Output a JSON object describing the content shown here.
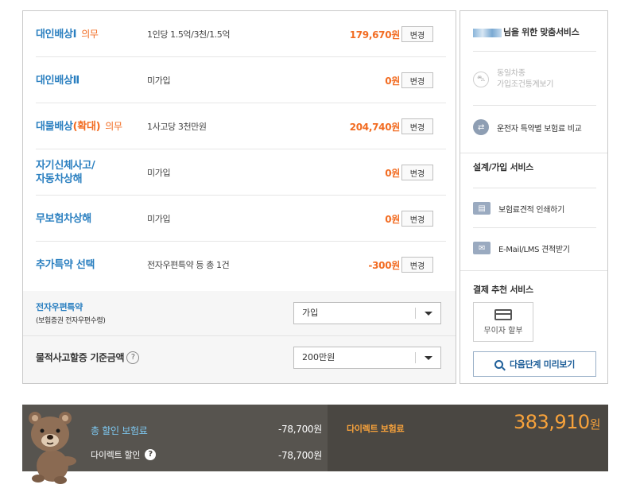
{
  "coverages": [
    {
      "name": "대인배상Ⅰ",
      "tag": "의무",
      "desc": "1인당 1.5억/3천/1.5억",
      "price": "179,670원",
      "btn": "변경"
    },
    {
      "name": "대인배상Ⅱ",
      "desc": "미가입",
      "price": "0원",
      "btn": "변경"
    },
    {
      "name": "대물배상",
      "name_hl": "(확대)",
      "tag": "의무",
      "desc": "1사고당 3천만원",
      "price": "204,740원",
      "btn": "변경"
    },
    {
      "name_line1": "자기신체사고/",
      "name_line2": "자동차상해",
      "desc": "미가입",
      "price": "0원",
      "btn": "변경"
    },
    {
      "name": "무보험차상해",
      "desc": "미가입",
      "price": "0원",
      "btn": "변경"
    },
    {
      "name": "추가특약 선택",
      "desc": "전자우편특약 등 총 1건",
      "price": "-300원",
      "btn": "변경"
    }
  ],
  "ebond": {
    "label": "전자우편특약",
    "sub": "(보험증권 전자우편수령)",
    "value": "가입"
  },
  "property": {
    "label": "물적사고할증 기준금액",
    "help": "?",
    "value": "200만원"
  },
  "side": {
    "custom_title": "님을 위한 맞춤서비스",
    "same_car_line1": "동일차종",
    "same_car_line2": "가입조건통계보기",
    "compare_label": "운전자 특약별 보험료 비교",
    "design_title": "설계/가입 서비스",
    "print_label": "보험료견적 인쇄하기",
    "email_label": "E-Mail/LMS 견적받기",
    "payment_title": "결제 추천 서비스",
    "no_interest_label": "무이자 할부",
    "preview_label": "다음단계 미리보기"
  },
  "bottom": {
    "total_discount_label": "총 할인 보험료",
    "total_discount_value": "-78,700원",
    "direct_discount_label": "다이렉트 할인",
    "direct_discount_help": "?",
    "direct_discount_value": "-78,700원",
    "premium_label": "다이렉트 보험료",
    "premium_value": "383,910",
    "premium_unit": "원"
  },
  "colors": {
    "accent_blue": "#2a7fc0",
    "accent_orange": "#f26c22",
    "premium_orange": "#f7a23b",
    "bar_bg": "#57544f"
  }
}
